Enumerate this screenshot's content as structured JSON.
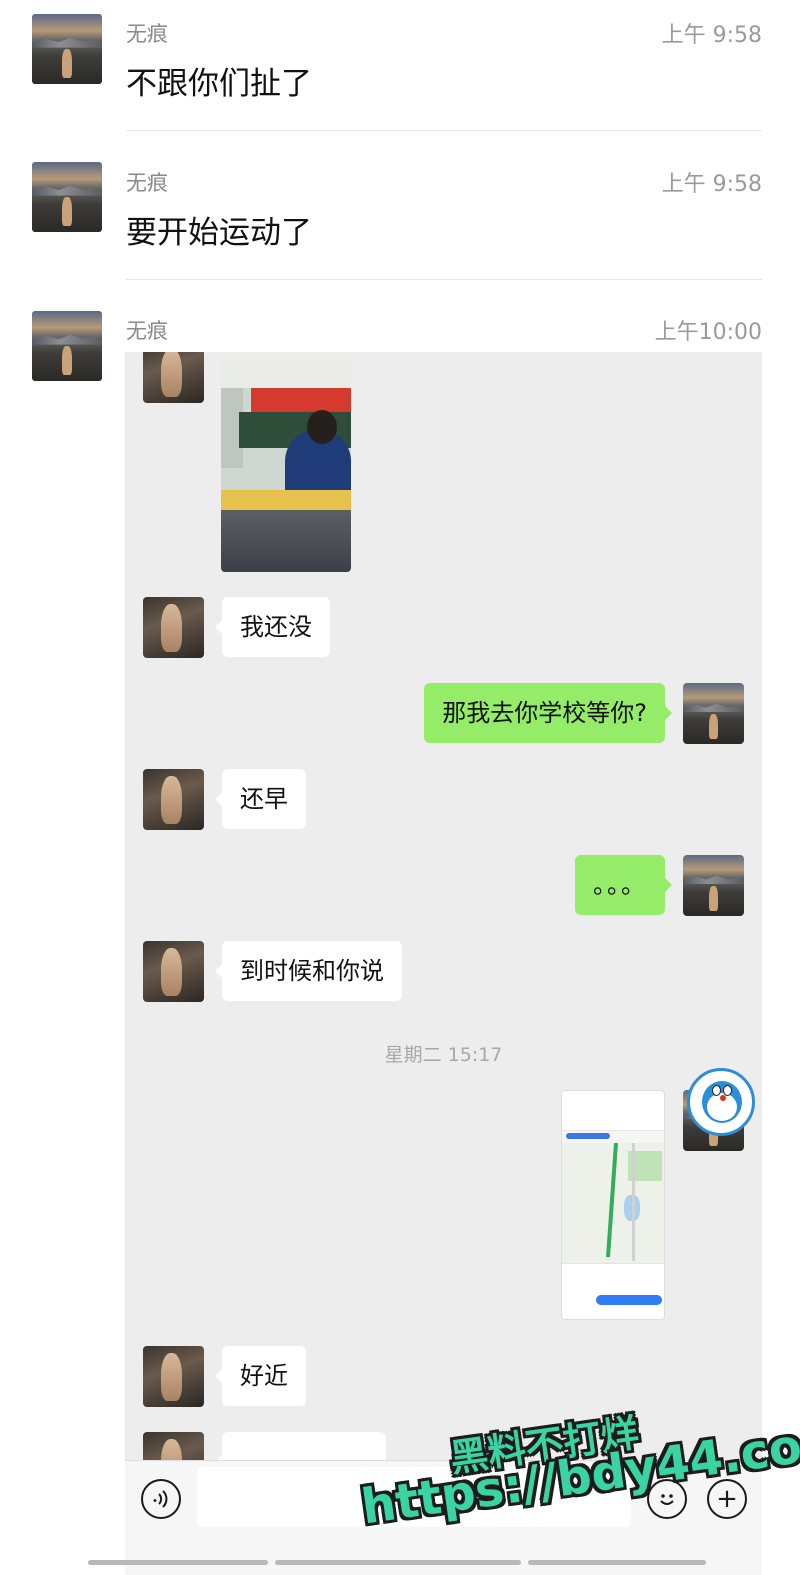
{
  "forwarded": [
    {
      "name": "无痕",
      "time": "上午 9:58",
      "text": "不跟你们扯了"
    },
    {
      "name": "无痕",
      "time": "上午 9:58",
      "text": "要开始运动了"
    },
    {
      "name": "无痕",
      "time": "上午10:00"
    }
  ],
  "chat": {
    "messages": [
      {
        "side": "in",
        "text": "我还没"
      },
      {
        "side": "out",
        "text": "那我去你学校等你?"
      },
      {
        "side": "in",
        "text": "还早"
      },
      {
        "side": "out",
        "text": "。。。"
      },
      {
        "side": "in",
        "text": "到时候和你说"
      },
      {
        "side": "in",
        "text": "好近"
      }
    ],
    "system_time": "星期二 15:17"
  },
  "watermark": {
    "line1": "黑料不打烊",
    "line2": "https://bdy44.co"
  },
  "icons": {
    "voice": "voice-icon",
    "emoji": "emoji-icon",
    "plus": "plus-icon"
  },
  "colors": {
    "bubble_out": "#95ec69",
    "bubble_in": "#ffffff",
    "chat_bg": "#ededed",
    "watermark": "#39d3a4"
  }
}
